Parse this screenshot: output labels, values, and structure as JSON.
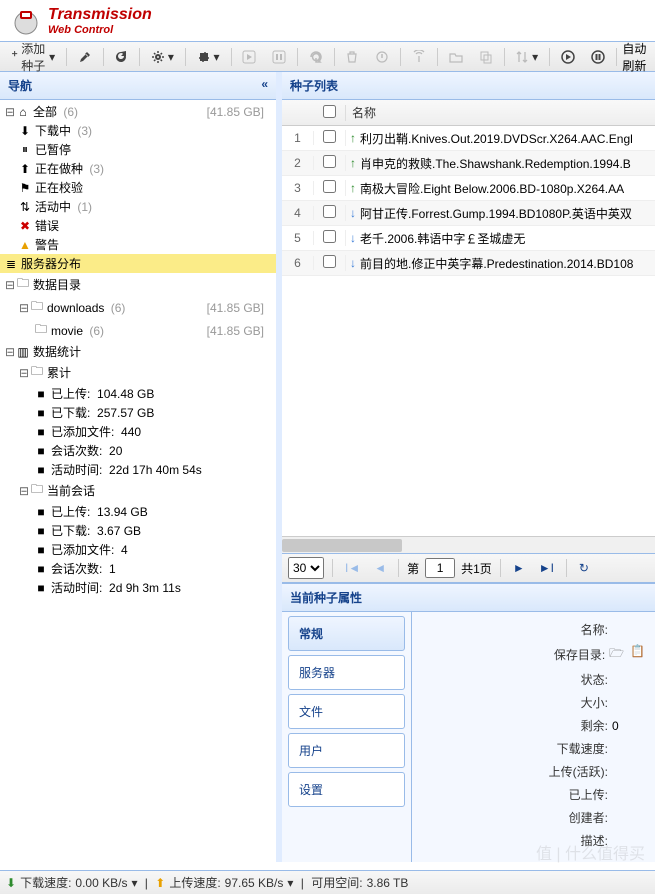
{
  "app": {
    "title": "Transmission",
    "subtitle": "Web Control"
  },
  "toolbar": {
    "add": "添加种子",
    "autorefresh": "自动刷新"
  },
  "nav": {
    "title": "导航",
    "all": {
      "label": "全部",
      "count": "(6)",
      "size": "[41.85 GB]"
    },
    "downloading": {
      "label": "下载中",
      "count": "(3)"
    },
    "paused": {
      "label": "已暂停"
    },
    "seeding": {
      "label": "正在做种",
      "count": "(3)"
    },
    "checking": {
      "label": "正在校验"
    },
    "active": {
      "label": "活动中",
      "count": "(1)"
    },
    "error": {
      "label": "错误"
    },
    "warning": {
      "label": "警告"
    },
    "servers": {
      "label": "服务器分布"
    },
    "datafolder": {
      "label": "数据目录"
    },
    "downloads": {
      "label": "downloads",
      "count": "(6)",
      "size": "[41.85 GB]"
    },
    "movie": {
      "label": "movie",
      "count": "(6)",
      "size": "[41.85 GB]"
    },
    "stats": {
      "label": "数据统计"
    },
    "total": {
      "label": "累计"
    },
    "t_up": {
      "label": "已上传:",
      "val": "104.48 GB"
    },
    "t_dn": {
      "label": "已下载:",
      "val": "257.57 GB"
    },
    "t_add": {
      "label": "已添加文件:",
      "val": "440"
    },
    "t_sess": {
      "label": "会话次数:",
      "val": "20"
    },
    "t_act": {
      "label": "活动时间:",
      "val": "22d 17h 40m 54s"
    },
    "session": {
      "label": "当前会话"
    },
    "s_up": {
      "label": "已上传:",
      "val": "13.94 GB"
    },
    "s_dn": {
      "label": "已下载:",
      "val": "3.67 GB"
    },
    "s_add": {
      "label": "已添加文件:",
      "val": "4"
    },
    "s_sess": {
      "label": "会话次数:",
      "val": "1"
    },
    "s_act": {
      "label": "活动时间:",
      "val": "2d 9h 3m 11s"
    }
  },
  "list": {
    "title": "种子列表",
    "col_name": "名称",
    "rows": [
      {
        "dir": "up",
        "name": "利刃出鞘.Knives.Out.2019.DVDScr.X264.AAC.Engl"
      },
      {
        "dir": "up",
        "name": "肖申克的救赎.The.Shawshank.Redemption.1994.B"
      },
      {
        "dir": "up",
        "name": "南极大冒险.Eight Below.2006.BD-1080p.X264.AA"
      },
      {
        "dir": "dn",
        "name": "阿甘正传.Forrest.Gump.1994.BD1080P.英语中英双"
      },
      {
        "dir": "dn",
        "name": "老千.2006.韩语中字￡圣城虚无"
      },
      {
        "dir": "dn",
        "name": "前目的地.修正中英字幕.Predestination.2014.BD108"
      }
    ]
  },
  "pager": {
    "pagesize": "30",
    "page_prefix": "第",
    "page": "1",
    "total": "共1页"
  },
  "props": {
    "title": "当前种子属性",
    "tabs": {
      "general": "常规",
      "servers": "服务器",
      "files": "文件",
      "users": "用户",
      "settings": "设置"
    },
    "fields": {
      "name": "名称:",
      "savepath": "保存目录:",
      "status": "状态:",
      "size": "大小:",
      "remain": "剩余:",
      "remain_val": "0",
      "dlspeed": "下载速度:",
      "ulspeed": "上传(活跃):",
      "uploaded": "已上传:",
      "creator": "创建者:",
      "desc": "描述:"
    }
  },
  "status": {
    "dl": "下载速度:",
    "dl_val": "0.00 KB/s",
    "ul": "上传速度:",
    "ul_val": "97.65 KB/s",
    "free": "可用空间:",
    "free_val": "3.86 TB"
  },
  "watermark": "值 | 什么值得买"
}
